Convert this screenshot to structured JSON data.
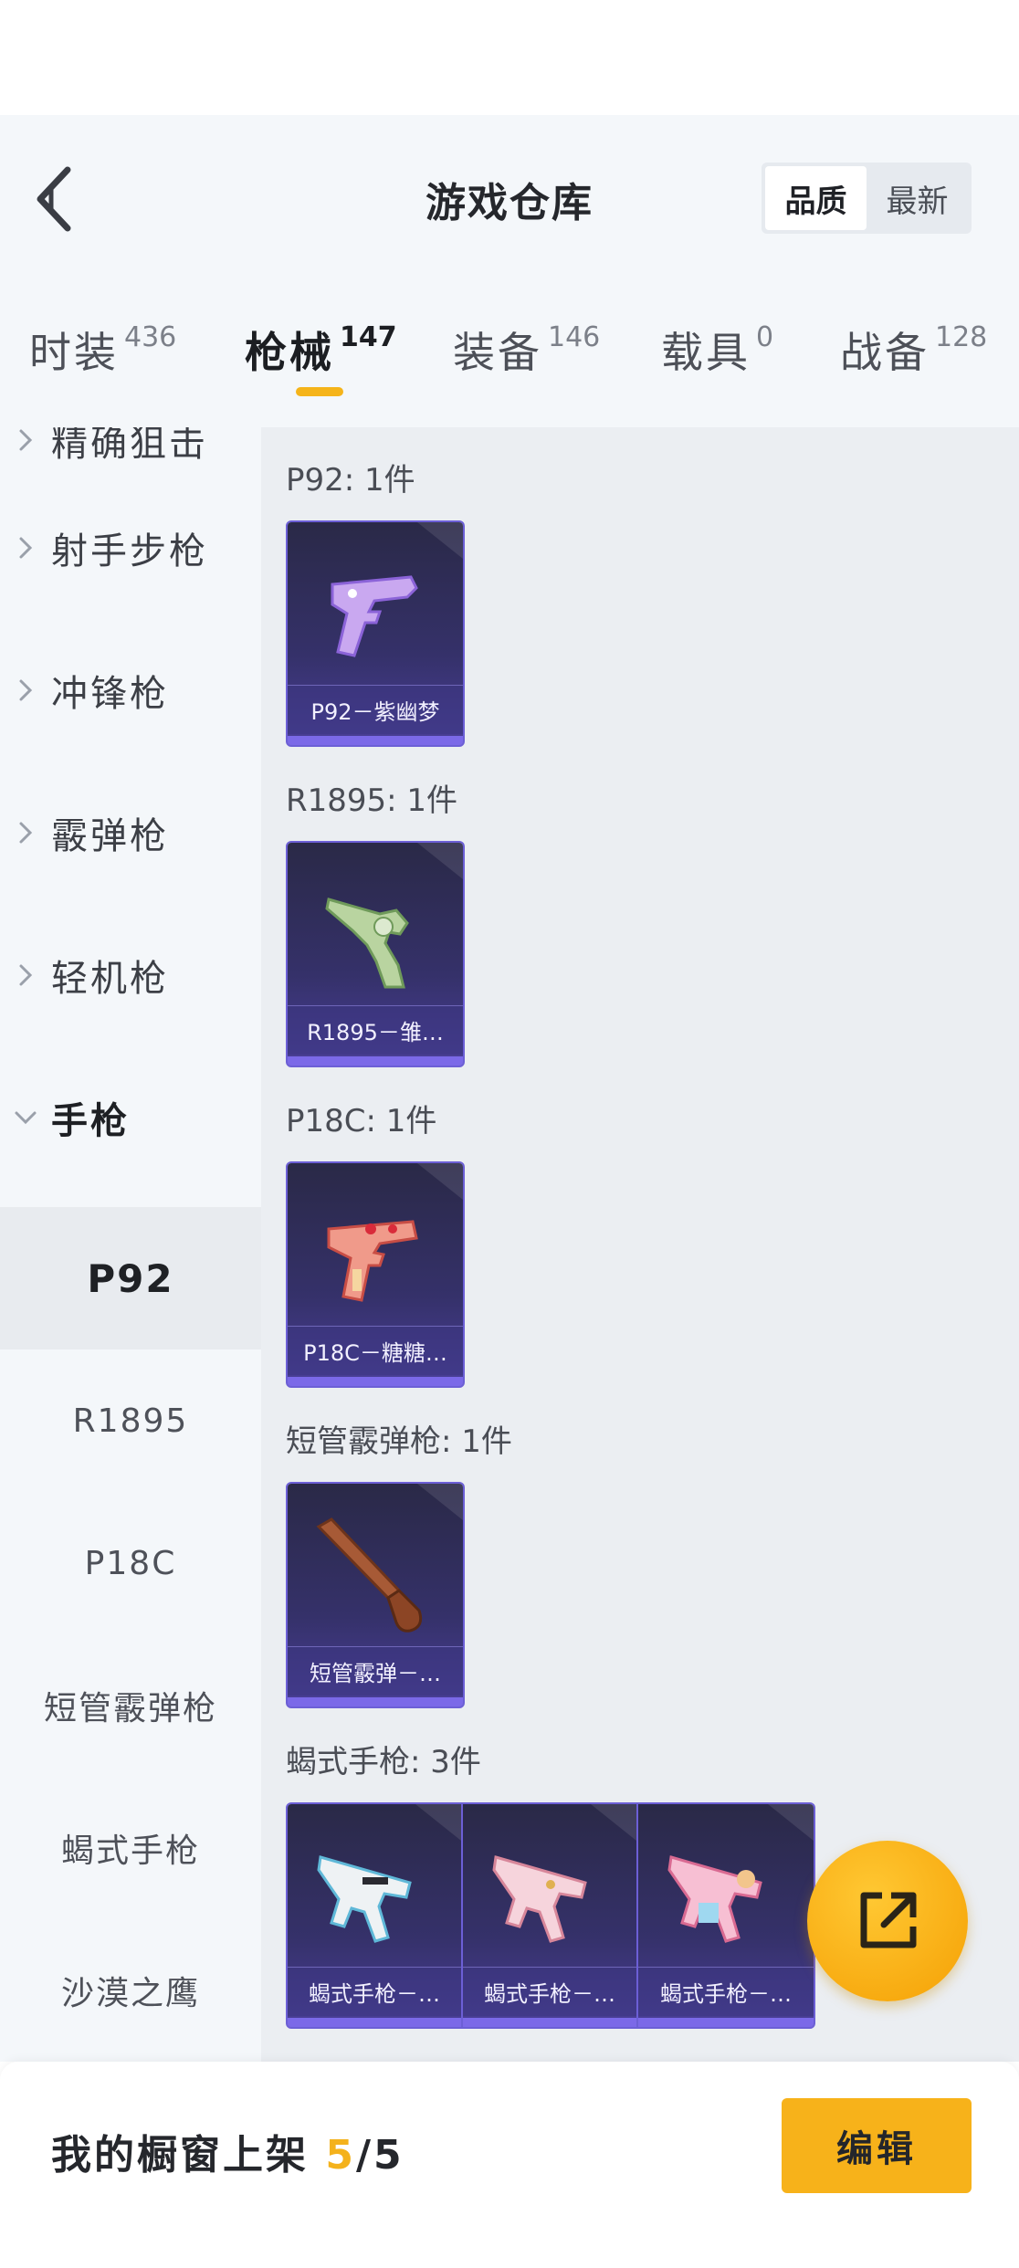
{
  "header": {
    "title": "游戏仓库",
    "sort_options": [
      "品质",
      "最新"
    ],
    "active_sort": "品质"
  },
  "tabs": [
    {
      "label": "时装",
      "count": "436"
    },
    {
      "label": "枪械",
      "count": "147",
      "active": true
    },
    {
      "label": "装备",
      "count": "146"
    },
    {
      "label": "载具",
      "count": "0"
    },
    {
      "label": "战备",
      "count": "128"
    }
  ],
  "sidebar": {
    "categories": [
      "精确狙击",
      "射手步枪",
      "冲锋枪",
      "霰弹枪",
      "轻机枪",
      "手枪"
    ],
    "open_category": "手枪",
    "sub_items": [
      "P92",
      "R1895",
      "P18C",
      "短管霰弹枪",
      "蝎式手枪",
      "沙漠之鹰"
    ],
    "active_sub": "P92"
  },
  "groups": [
    {
      "title": "P92: 1件",
      "items": [
        {
          "label": "P92－紫幽梦",
          "icon": "pistol-purple-icon"
        }
      ]
    },
    {
      "title": "R1895: 1件",
      "items": [
        {
          "label": "R1895－雏…",
          "icon": "revolver-green-icon"
        }
      ]
    },
    {
      "title": "P18C: 1件",
      "items": [
        {
          "label": "P18C－糖糖…",
          "icon": "pistol-candy-icon"
        }
      ]
    },
    {
      "title": "短管霰弹枪: 1件",
      "items": [
        {
          "label": "短管霰弹－…",
          "icon": "sawed-off-shotgun-icon"
        }
      ]
    },
    {
      "title": "蝎式手枪: 3件",
      "items": [
        {
          "label": "蝎式手枪－…",
          "icon": "scorpion-pistol-white-icon"
        },
        {
          "label": "蝎式手枪－…",
          "icon": "scorpion-pistol-pink-icon"
        },
        {
          "label": "蝎式手枪－…",
          "icon": "scorpion-pistol-pastel-icon"
        }
      ]
    }
  ],
  "footer": {
    "showcase_label": "我的橱窗上架 ",
    "showcase_current": "5",
    "showcase_sep_total": "/5",
    "edit_label": "编辑"
  },
  "colors": {
    "accent": "#f7b21a",
    "card_border": "#6c5fd6",
    "content_bg": "#ebeef2"
  }
}
